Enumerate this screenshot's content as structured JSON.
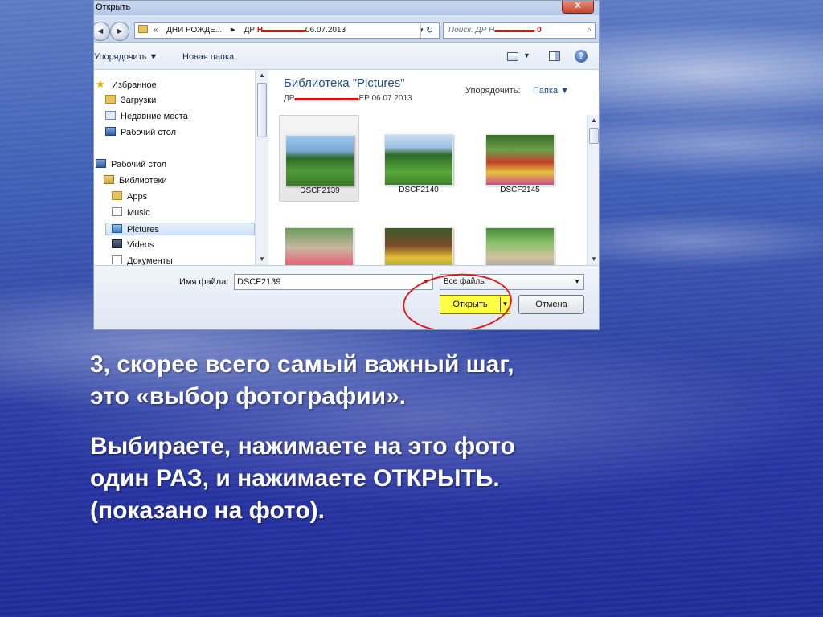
{
  "dialog": {
    "title": "Открыть",
    "close_glyph": "x",
    "address": {
      "back_glyph": "◄",
      "forward_glyph": "►",
      "prefix": "«",
      "crumb1": "ДНИ РОЖДЕ...",
      "separator": "►",
      "crumb2_start": "ДР ",
      "crumb2_scribble": "Н▬▬▬▬▬▬",
      "crumb2_end": "06.07.2013",
      "dropdown_glyph": "▼",
      "refresh_glyph": "↻"
    },
    "search": {
      "placeholder_start": "Поиск: ДР Н",
      "placeholder_scribble": "▬▬▬▬▬ 0",
      "search_glyph": "⌕"
    },
    "toolbar": {
      "organize": "Упорядочить ▼",
      "new_folder": "Новая папка",
      "view_dd": "▼",
      "help": "?"
    },
    "nav": {
      "favorites": "Избранное",
      "downloads": "Загрузки",
      "recent": "Недавние места",
      "desktop1": "Рабочий стол",
      "desktop2": "Рабочий стол",
      "libraries": "Библиотеки",
      "apps": "Apps",
      "music": "Music",
      "pictures": "Pictures",
      "videos": "Videos",
      "documents": "Документы",
      "star_glyph": "★",
      "scroll_up": "▲",
      "scroll_down": "▼"
    },
    "content": {
      "library_title": "Библиотека \"Pictures\"",
      "library_sub_start": "ДР",
      "library_sub_scribble": "▬▬▬▬▬▬▬▬",
      "library_sub_end": "ЕР 06.07.2013",
      "arrange_label": "Упорядочить:",
      "arrange_value": "Папка ▼",
      "files": [
        {
          "name": "DSCF2139"
        },
        {
          "name": "DSCF2140"
        },
        {
          "name": "DSCF2145"
        }
      ],
      "scroll_up": "▲",
      "scroll_down": "▼"
    },
    "footer": {
      "filename_label": "Имя файла:",
      "filename_value": "DSCF2139",
      "filename_dd": "▼",
      "filter_value": "Все файлы",
      "filter_dd": "▼",
      "open_label": "Открыть",
      "open_split": "▼",
      "cancel_label": "Отмена"
    }
  },
  "slide": {
    "paragraph1": "3, скорее всего самый важный шаг, это «выбор фотографии».",
    "paragraph2": "Выбираете, нажимаете на это фото один РАЗ, и нажимаете ОТКРЫТЬ. (показано на фото)."
  },
  "colors": {
    "highlight": "#ffff44",
    "marker": "#e01a1a",
    "library_title": "#1e4d8c"
  }
}
